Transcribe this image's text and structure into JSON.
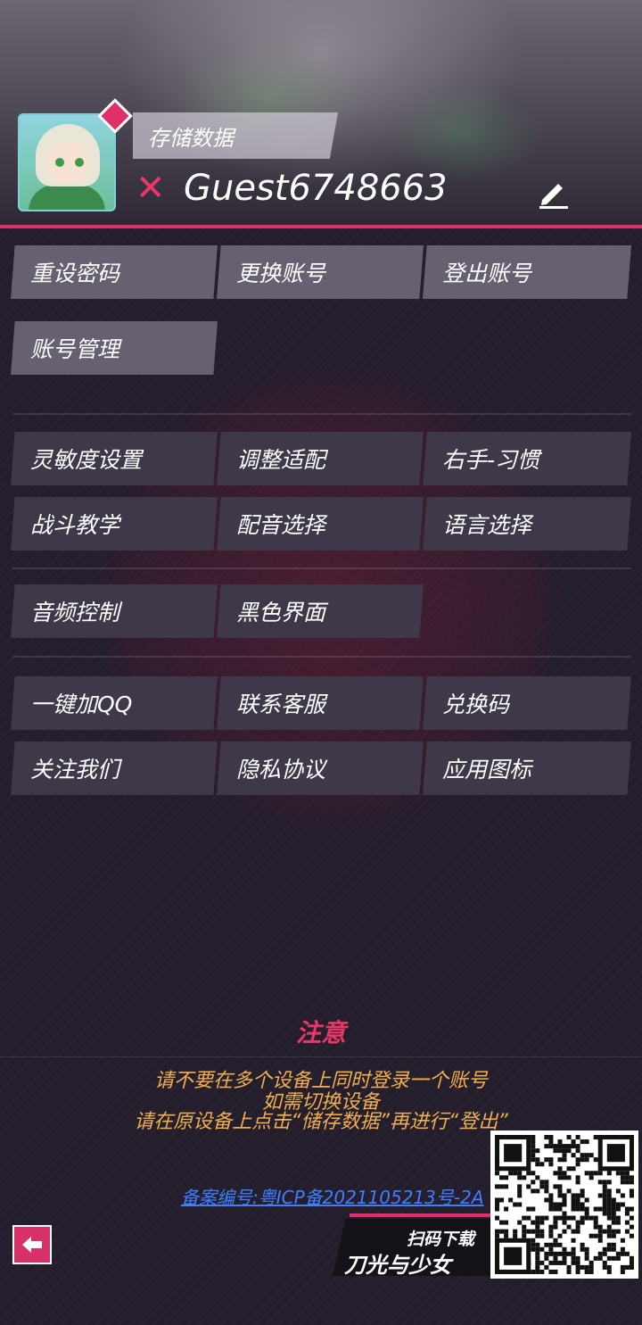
{
  "header": {
    "save_label": "存储数据",
    "username": "Guest6748663",
    "status_icon": "x-mark-icon",
    "edit_icon": "pencil-icon"
  },
  "account_buttons": [
    "重设密码",
    "更换账号",
    "登出账号",
    "账号管理"
  ],
  "settings_buttons": [
    "灵敏度设置",
    "调整适配",
    "右手-习惯",
    "战斗教学",
    "配音选择",
    "语言选择"
  ],
  "display_buttons": [
    "音频控制",
    "黑色界面"
  ],
  "social_buttons": [
    "一键加QQ",
    "联系客服",
    "兑换码",
    "关注我们",
    "隐私协议",
    "应用图标"
  ],
  "notice": {
    "title": "注意",
    "lines": [
      "请不要在多个设备上同时登录一个账号",
      "如需切换设备",
      "请在原设备上点击“储存数据”再进行“登出”"
    ],
    "icp": "备案编号:粤ICP备2021105213号-2A"
  },
  "download": {
    "subtitle": "扫码下载",
    "game_name": "刀光与少女"
  },
  "colors": {
    "accent": "#e0306a",
    "notice_text": "#f0b050",
    "link": "#3e7fff",
    "button": "#666070",
    "button_dark": "#3e3848"
  }
}
